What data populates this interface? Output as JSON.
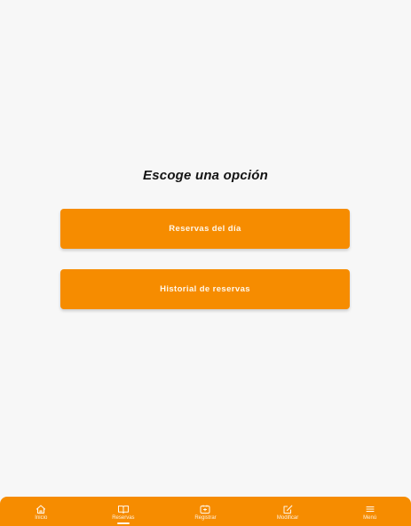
{
  "main": {
    "title": "Escoge una opción",
    "options": [
      {
        "label": "Reservas del día"
      },
      {
        "label": "Historial de reservas"
      }
    ]
  },
  "bottom_nav": {
    "items": [
      {
        "label": "Inicio",
        "icon": "home-icon"
      },
      {
        "label": "Reservas",
        "icon": "book-icon",
        "active": true
      },
      {
        "label": "Registrar",
        "icon": "register-icon"
      },
      {
        "label": "Modificar",
        "icon": "edit-icon"
      },
      {
        "label": "Menú",
        "icon": "menu-icon"
      }
    ]
  },
  "colors": {
    "accent": "#f68c00",
    "background": "#f7f7f7",
    "title_text": "#141414"
  }
}
